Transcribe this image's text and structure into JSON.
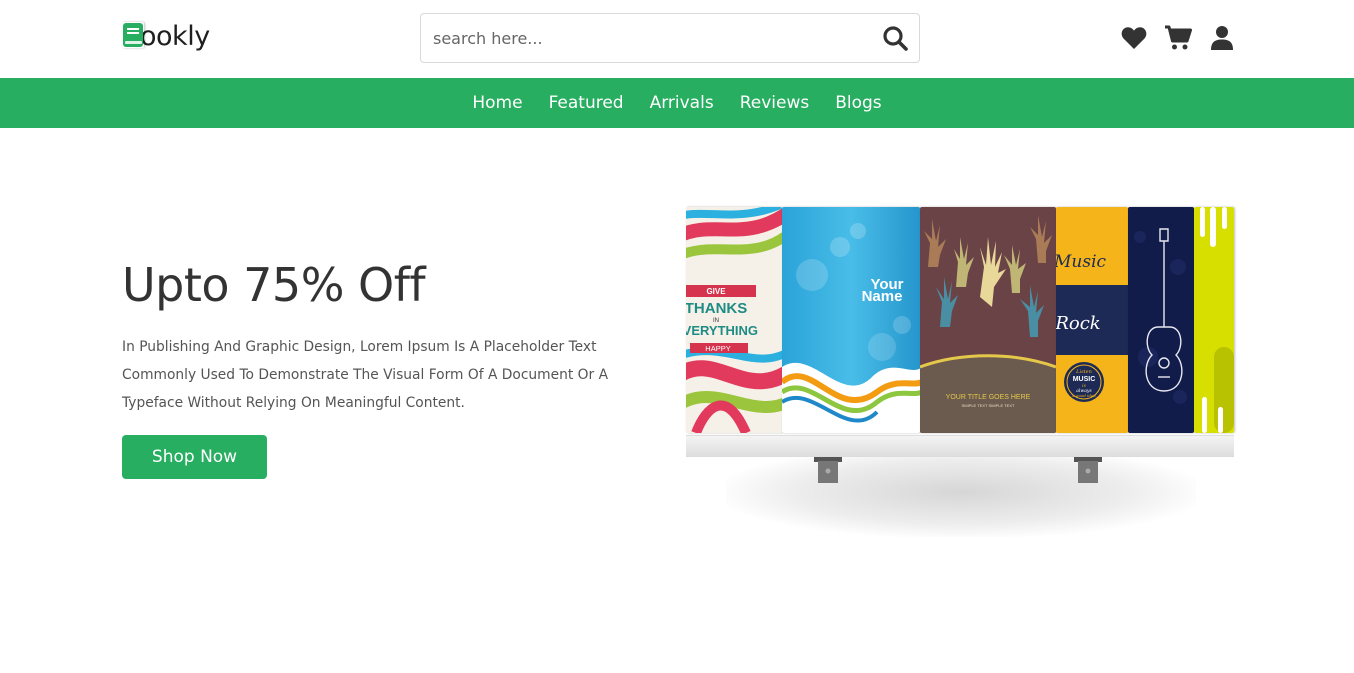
{
  "header": {
    "logo_text": "Bookly",
    "search_placeholder": "search here...",
    "icons": [
      "heart-icon",
      "cart-icon",
      "user-icon"
    ]
  },
  "nav": {
    "items": [
      "Home",
      "Featured",
      "Arrivals",
      "Reviews",
      "Blogs"
    ]
  },
  "hero": {
    "title": "Upto 75% Off",
    "description": "In Publishing And Graphic Design, Lorem Ipsum Is A Placeholder Text Commonly Used To Demonstrate The Visual Form Of A Document Or A Typeface Without Relying On Meaningful Content.",
    "button_label": "Shop Now"
  },
  "books": {
    "book1_text": [
      "GIVE",
      "THANKS",
      "IN",
      "EVERYTHING",
      "HAPPY"
    ],
    "book2_text": [
      "Your",
      "Name"
    ],
    "book3_text": [
      "YOUR TITLE GOES HERE",
      "SIMPLE TEXT SIMPLE TEXT"
    ],
    "book4_text": [
      "Music",
      "Rock",
      "Listen",
      "MUSIC",
      "is",
      "always",
      "a good idea"
    ]
  },
  "colors": {
    "brand": "#27ae60",
    "text_dark": "#333333"
  }
}
